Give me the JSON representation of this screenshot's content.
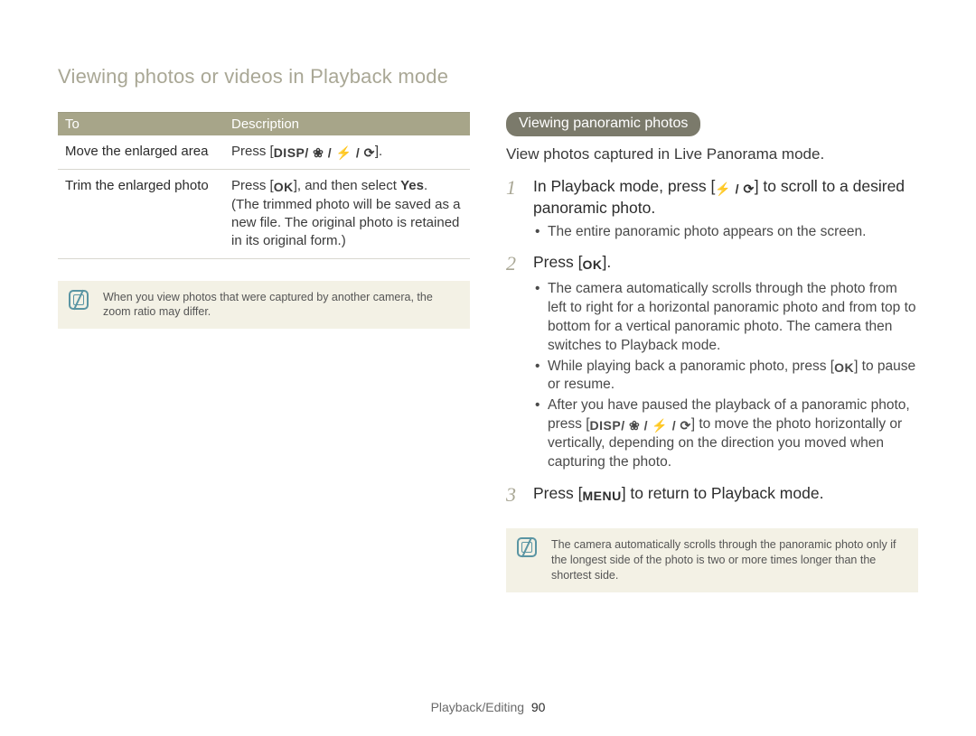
{
  "page_title": "Viewing photos or videos in Playback mode",
  "table": {
    "headers": {
      "to": "To",
      "desc": "Description"
    },
    "rows": [
      {
        "label": "Move the enlarged area",
        "desc_pre": "Press [",
        "desc_sym": "DISP/ ❀ / ⚡ / ⟳",
        "desc_post": "]."
      },
      {
        "label": "Trim the enlarged photo",
        "desc_l1_pre": "Press [",
        "desc_l1_sym": "OK",
        "desc_l1_mid": "], and then select ",
        "desc_l1_bold": "Yes",
        "desc_l1_end": ".",
        "desc_rest": "(The trimmed photo will be saved as a new file. The original photo is retained in its original form.)"
      }
    ]
  },
  "note_left": "When you view photos that were captured by another camera, the zoom ratio may differ.",
  "section_pill": "Viewing panoramic photos",
  "section_intro": "View photos captured in Live Panorama mode.",
  "steps": [
    {
      "num": "1",
      "pre": "In Playback mode, press [",
      "sym": "⚡ / ⟳",
      "post": "] to scroll to a desired panoramic photo.",
      "bullets": [
        {
          "text": "The entire panoramic photo appears on the screen."
        }
      ]
    },
    {
      "num": "2",
      "pre": "Press [",
      "sym": "OK",
      "post": "].",
      "bullets": [
        {
          "text": "The camera automatically scrolls through the photo from left to right for a horizontal panoramic photo and from top to bottom for a vertical panoramic photo. The camera then switches to Playback mode."
        },
        {
          "pre": "While playing back a panoramic photo, press [",
          "sym": "OK",
          "post": "] to pause or resume."
        },
        {
          "pre": "After you have paused the playback of a panoramic photo, press [",
          "sym": "DISP/ ❀ / ⚡ / ⟳",
          "post": "] to move the photo horizontally or vertically, depending on the direction you moved when capturing the photo."
        }
      ]
    },
    {
      "num": "3",
      "pre": "Press [",
      "sym": "MENU",
      "post": "] to return to Playback mode.",
      "bullets": []
    }
  ],
  "note_right": "The camera automatically scrolls through the panoramic photo only if the longest side of the photo is two or more times longer than the shortest side.",
  "footer": {
    "section": "Playback/Editing",
    "page": "90"
  }
}
